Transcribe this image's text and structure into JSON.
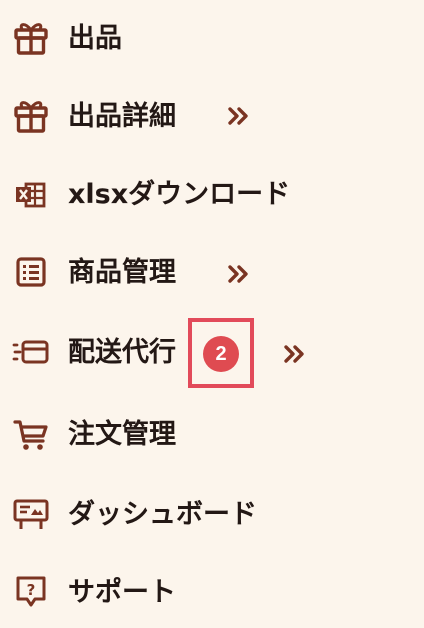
{
  "menu": {
    "items": [
      {
        "label": "出品"
      },
      {
        "label": "出品詳細"
      },
      {
        "label": "xlsxダウンロード"
      },
      {
        "label": "商品管理"
      },
      {
        "label": "配送代行"
      },
      {
        "label": "注文管理"
      },
      {
        "label": "ダッシュボード"
      },
      {
        "label": "サポート"
      }
    ],
    "badge_count": "2"
  },
  "colors": {
    "background": "#fcf5ec",
    "icon": "#7a3422",
    "text": "#231815",
    "badge": "#df4b51",
    "highlight_border": "#e24a5a"
  },
  "icons": [
    "gift-icon",
    "gift-icon",
    "excel-file-icon",
    "list-icon",
    "delivery-card-icon",
    "shopping-cart-icon",
    "dashboard-board-icon",
    "support-question-icon"
  ]
}
